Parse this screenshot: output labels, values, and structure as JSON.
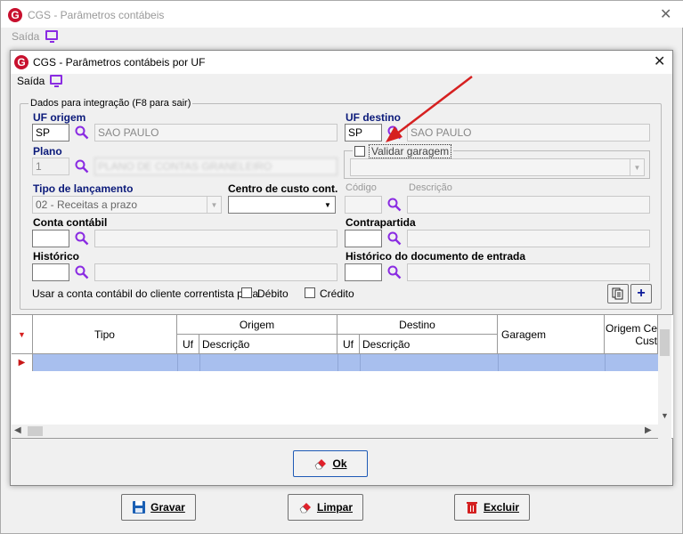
{
  "outer_window": {
    "title": "CGS - Parâmetros contábeis",
    "menu_saida": "Saída"
  },
  "inner_window": {
    "title": "CGS - Parâmetros contábeis por UF",
    "menu_saida": "Saída"
  },
  "form": {
    "group_legend": "Dados para integração  (F8 para sair)",
    "uf_origem_label": "UF origem",
    "uf_origem_value": "SP",
    "uf_origem_name": "SAO PAULO",
    "uf_destino_label": "UF destino",
    "uf_destino_value": "SP",
    "uf_destino_name": "SAO PAULO",
    "plano_label": "Plano",
    "plano_value": "1",
    "plano_name": "PLANO DE CONTAS GRANELEIRO",
    "validar_garagem_label": "Validar garagem",
    "tipo_lancamento_label": "Tipo de lançamento",
    "tipo_lancamento_value": "02 - Receitas a prazo",
    "centro_custo_label": "Centro de custo cont.",
    "centro_custo_value": "",
    "codigo_label": "Código",
    "descricao_label": "Descrição",
    "conta_contabil_label": "Conta contábil",
    "contrapartida_label": "Contrapartida",
    "historico_label": "Histórico",
    "historico_doc_label": "Histórico do documento de entrada",
    "usar_conta_label": "Usar a conta contábil do cliente correntista para",
    "debito_label": "Débito",
    "credito_label": "Crédito"
  },
  "grid": {
    "col_tipo": "Tipo",
    "col_origem": "Origem",
    "col_destino": "Destino",
    "col_uf": "Uf",
    "col_descricao": "Descrição",
    "col_garagem": "Garagem",
    "col_origem_cc_1": "Origem Ce",
    "col_origem_cc_2": "Cust"
  },
  "buttons": {
    "ok": "Ok",
    "gravar": "Gravar",
    "limpar": "Limpar",
    "excluir": "Excluir"
  },
  "colors": {
    "label_blue": "#0b1a7a",
    "selected_row": "#a8bfee",
    "arrow_red": "#d62020",
    "accent_purple": "#8a2be2"
  }
}
